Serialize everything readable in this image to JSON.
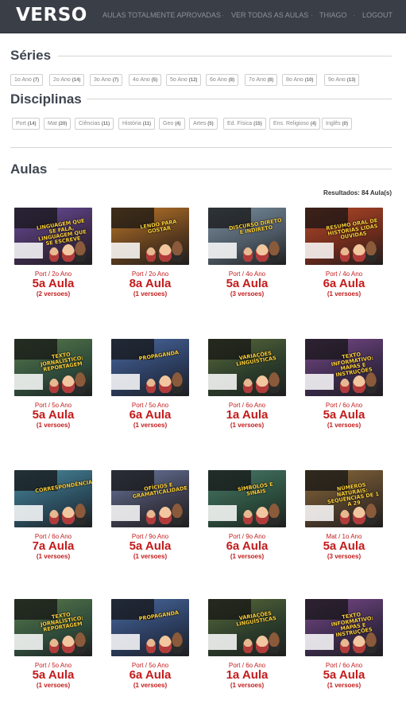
{
  "brand": "VERSO",
  "nav": [
    "AULAS TOTALMENTE APROVADAS",
    "VER TODAS AS AULAS",
    "THIAGO",
    "LOGOUT"
  ],
  "nav_separator": "·",
  "series": {
    "title": "Séries",
    "chips": [
      {
        "label": "1o Ano",
        "count": "(7)"
      },
      {
        "label": "2o Ano",
        "count": "(14)"
      },
      {
        "label": "3o Ano",
        "count": "(7)"
      },
      {
        "label": "4o Ano",
        "count": "(5)"
      },
      {
        "label": "5o Ano",
        "count": "(12)"
      },
      {
        "label": "6o Ano",
        "count": "(8)"
      },
      {
        "label": "7o Ano",
        "count": "(8)"
      },
      {
        "label": "8o Ano",
        "count": "(10)"
      },
      {
        "label": "9o Ano",
        "count": "(13)"
      }
    ]
  },
  "disciplinas": {
    "title": "Disciplinas",
    "chips": [
      {
        "label": "Port",
        "count": "(14)"
      },
      {
        "label": "Mat",
        "count": "(20)"
      },
      {
        "label": "Ciências",
        "count": "(11)"
      },
      {
        "label": "História",
        "count": "(11)"
      },
      {
        "label": "Geo",
        "count": "(4)"
      },
      {
        "label": "Artes",
        "count": "(5)"
      },
      {
        "label": "Ed. Física",
        "count": "(15)"
      },
      {
        "label": "Ens. Religioso",
        "count": "(4)"
      },
      {
        "label": "Inglês",
        "count": "(0)"
      }
    ]
  },
  "aulas": {
    "title": "Aulas",
    "results": "Resultados: 84 Aula(s)",
    "cards": [
      {
        "subject": "Port / 2o Ano",
        "lesson": "5a Aula",
        "versions": "(2 versoes)",
        "thumb_title": "LINGUAGEM QUE SE FALA, LINGUAGEM QUE SE ESCREVE",
        "bg": "#3c2a4a",
        "accent": "#6a4fa0"
      },
      {
        "subject": "Port / 2o Ano",
        "lesson": "8a Aula",
        "versions": "(1 versoes)",
        "thumb_title": "LENDO PARA GOSTAR",
        "bg": "#5a3b1e",
        "accent": "#c17a2a"
      },
      {
        "subject": "Port / 4o Ano",
        "lesson": "5a Aula",
        "versions": "(3 versoes)",
        "thumb_title": "DISCURSO DIRETO E INDIRETO",
        "bg": "#4a5560",
        "accent": "#7a8fa0"
      },
      {
        "subject": "Port / 4o Ano",
        "lesson": "6a Aula",
        "versions": "(1 versoes)",
        "thumb_title": "RESUMO ORAL DE HISTÓRIAS LIDAS OUVIDAS",
        "bg": "#6a2a1c",
        "accent": "#b54a2a"
      },
      {
        "subject": "Port / 5o Ano",
        "lesson": "5a Aula",
        "versions": "(1 versoes)",
        "thumb_title": "TEXTO JORNALÍSTICO: REPORTAGEM",
        "bg": "#2e4a3a",
        "accent": "#5a7a4a"
      },
      {
        "subject": "Port / 5o Ano",
        "lesson": "6a Aula",
        "versions": "(1 versoes)",
        "thumb_title": "PROPAGANDA",
        "bg": "#2a3a5a",
        "accent": "#4a6aa0"
      },
      {
        "subject": "Port / 6o Ano",
        "lesson": "1a Aula",
        "versions": "(1 versoes)",
        "thumb_title": "VARIAÇÕES LINGUÍSTICAS",
        "bg": "#2a3a2a",
        "accent": "#5a6a3a"
      },
      {
        "subject": "Port / 6o Ano",
        "lesson": "5a Aula",
        "versions": "(1 versoes)",
        "thumb_title": "TEXTO INFORMATIVO: MAPAS E INSTRUÇÕES",
        "bg": "#3a2a4a",
        "accent": "#7a4a8a"
      },
      {
        "subject": "Port / 6o Ano",
        "lesson": "7a Aula",
        "versions": "(1 versoes)",
        "thumb_title": "CORRESPONDÊNCIAS",
        "bg": "#2a4a5a",
        "accent": "#4a8aa0"
      },
      {
        "subject": "Port / 9o Ano",
        "lesson": "5a Aula",
        "versions": "(1 versoes)",
        "thumb_title": "OFÍCIOS E GRAMATICALIDADE",
        "bg": "#3a3a4a",
        "accent": "#6a7aa0"
      },
      {
        "subject": "Port / 9o Ano",
        "lesson": "6a Aula",
        "versions": "(1 versoes)",
        "thumb_title": "SÍMBOLOS E SINAIS",
        "bg": "#2a4a3a",
        "accent": "#4a7a6a"
      },
      {
        "subject": "Mat / 1o Ano",
        "lesson": "5a Aula",
        "versions": "(3 versoes)",
        "thumb_title": "NÚMEROS NATURAIS: SEQUÊNCIAS DE 1 A 29",
        "bg": "#4a3a2a",
        "accent": "#8a6a3a"
      },
      {
        "subject": "Port / 5o Ano",
        "lesson": "5a Aula",
        "versions": "(1 versoes)",
        "thumb_title": "TEXTO JORNALÍSTICO: REPORTAGEM",
        "bg": "#2e4a3a",
        "accent": "#5a7a4a"
      },
      {
        "subject": "Port / 5o Ano",
        "lesson": "6a Aula",
        "versions": "(1 versoes)",
        "thumb_title": "PROPAGANDA",
        "bg": "#2a3a5a",
        "accent": "#4a6aa0"
      },
      {
        "subject": "Port / 6o Ano",
        "lesson": "1a Aula",
        "versions": "(1 versoes)",
        "thumb_title": "VARIAÇÕES LINGUÍSTICAS",
        "bg": "#2a3a2a",
        "accent": "#5a6a3a"
      },
      {
        "subject": "Port / 6o Ano",
        "lesson": "5a Aula",
        "versions": "(1 versoes)",
        "thumb_title": "TEXTO INFORMATIVO: MAPAS E INSTRUÇÕES",
        "bg": "#3a2a4a",
        "accent": "#7a4a8a"
      }
    ]
  },
  "colors": {
    "topbar": "#3a3f47",
    "accent_red": "#c31c1c"
  }
}
